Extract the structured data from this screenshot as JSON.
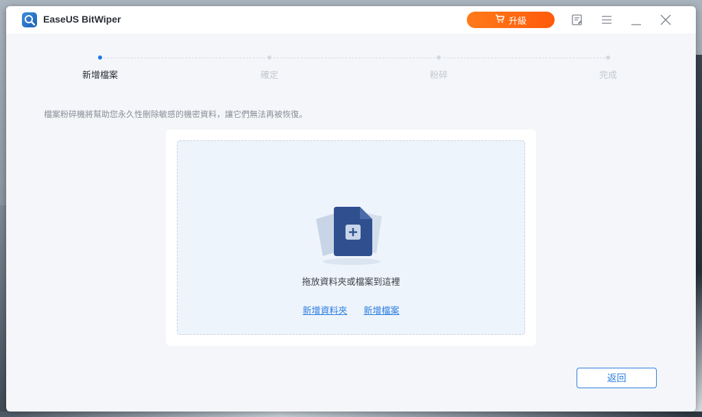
{
  "window": {
    "title": "EaseUS BitWiper"
  },
  "toolbar": {
    "upgrade_label": "升級"
  },
  "steps": [
    {
      "label": "新增檔案",
      "active": true
    },
    {
      "label": "確定",
      "active": false
    },
    {
      "label": "粉碎",
      "active": false
    },
    {
      "label": "完成",
      "active": false
    }
  ],
  "description": "檔案粉碎機將幫助您永久性刪除敏感的機密資料，讓它們無法再被恢復。",
  "dropzone": {
    "text": "拖放資料夾或檔案到這裡",
    "add_folder_label": "新增資料夾",
    "add_file_label": "新增檔案"
  },
  "footer": {
    "back_label": "返回"
  },
  "colors": {
    "accent": "#2a7de1",
    "upgrade": "#ff6a10",
    "active_step": "#1e7ae6"
  }
}
